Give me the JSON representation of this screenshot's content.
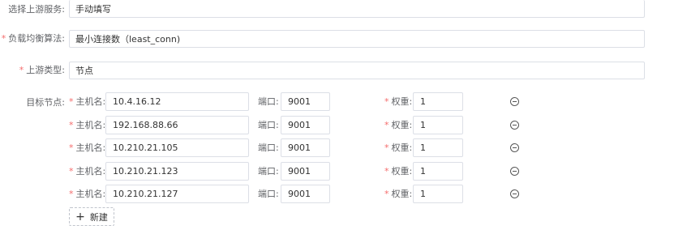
{
  "form": {
    "upstream_service": {
      "label": "选择上游服务:",
      "value": "手动填写"
    },
    "load_balance": {
      "required_mark": "*",
      "label": "负载均衡算法:",
      "value": "最小连接数（least_conn)"
    },
    "upstream_type": {
      "required_mark": "*",
      "label": "上游类型:",
      "value": "节点"
    },
    "target_nodes": {
      "label": "目标节点:",
      "required_mark": "*",
      "host_label": "主机名:",
      "port_label": "端口:",
      "weight_label": "权重:",
      "rows": [
        {
          "host": "10.4.16.12",
          "port": "9001",
          "weight": "1"
        },
        {
          "host": "192.168.88.66",
          "port": "9001",
          "weight": "1"
        },
        {
          "host": "10.210.21.105",
          "port": "9001",
          "weight": "1"
        },
        {
          "host": "10.210.21.123",
          "port": "9001",
          "weight": "1"
        },
        {
          "host": "10.210.21.127",
          "port": "9001",
          "weight": "1"
        }
      ]
    },
    "add_button": {
      "icon": "plus-icon",
      "label": "新建"
    }
  },
  "colors": {
    "required": "#f56c6c",
    "border": "#dcdfe6",
    "label": "#606266"
  }
}
